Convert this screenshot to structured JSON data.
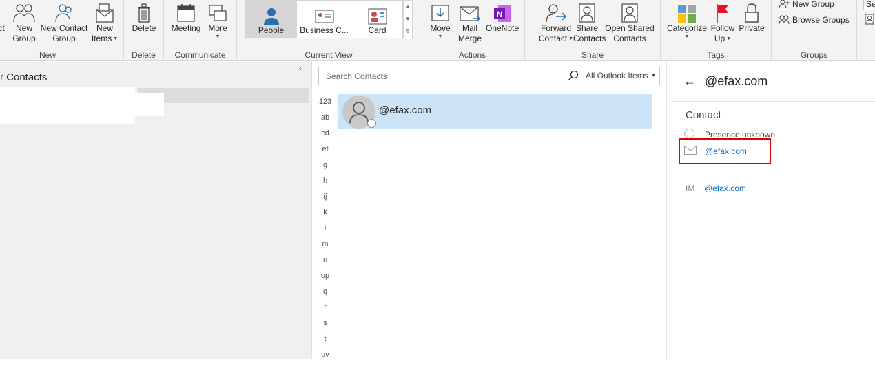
{
  "ribbon": {
    "new_group": {
      "label": "New",
      "buttons": [
        {
          "label1": "",
          "label2": "ct"
        },
        {
          "label1": "New",
          "label2": "Group"
        },
        {
          "label1": "New Contact",
          "label2": "Group"
        },
        {
          "label1": "New",
          "label2": "Items"
        }
      ]
    },
    "delete_group": {
      "label": "Delete",
      "button": "Delete"
    },
    "communicate_group": {
      "label": "Communicate",
      "meeting": "Meeting",
      "more": "More"
    },
    "current_view_group": {
      "label": "Current View",
      "views": [
        "People",
        "Business C...",
        "Card"
      ],
      "selected": "People"
    },
    "actions_group": {
      "label": "Actions",
      "move": "Move",
      "mail_merge_1": "Mail",
      "mail_merge_2": "Merge",
      "onenote": "OneNote"
    },
    "share_group": {
      "label": "Share",
      "forward_1": "Forward",
      "forward_2": "Contact",
      "share_1": "Share",
      "share_2": "Contacts",
      "open_shared_1": "Open Shared",
      "open_shared_2": "Contacts"
    },
    "tags_group": {
      "label": "Tags",
      "categorize": "Categorize",
      "follow_up_1": "Follow",
      "follow_up_2": "Up",
      "private": "Private"
    },
    "groups_group": {
      "label": "Groups",
      "new_group": "New Group",
      "browse_groups": "Browse Groups"
    },
    "search_people": "Sea"
  },
  "folder_pane": {
    "title": "r Contacts",
    "collapse_glyph": "‹"
  },
  "contact_list": {
    "search_placeholder": "Search Contacts",
    "scope": "All Outlook Items",
    "index": [
      "123",
      "ab",
      "cd",
      "ef",
      "g",
      "h",
      "ij",
      "k",
      "l",
      "m",
      "n",
      "op",
      "q",
      "r",
      "s",
      "t",
      "uv"
    ],
    "selected_contact": "@efax.com"
  },
  "detail": {
    "back_glyph": "←",
    "title": "@efax.com",
    "section": "Contact",
    "presence": "Presence unknown",
    "email": "@efax.com",
    "im_label": "IM",
    "im_value": "@efax.com"
  },
  "colors": {
    "ribbon_bg": "#f3f3f3",
    "selection": "#cce4f7",
    "link": "#0f6cbd",
    "highlight": "#e00000"
  }
}
